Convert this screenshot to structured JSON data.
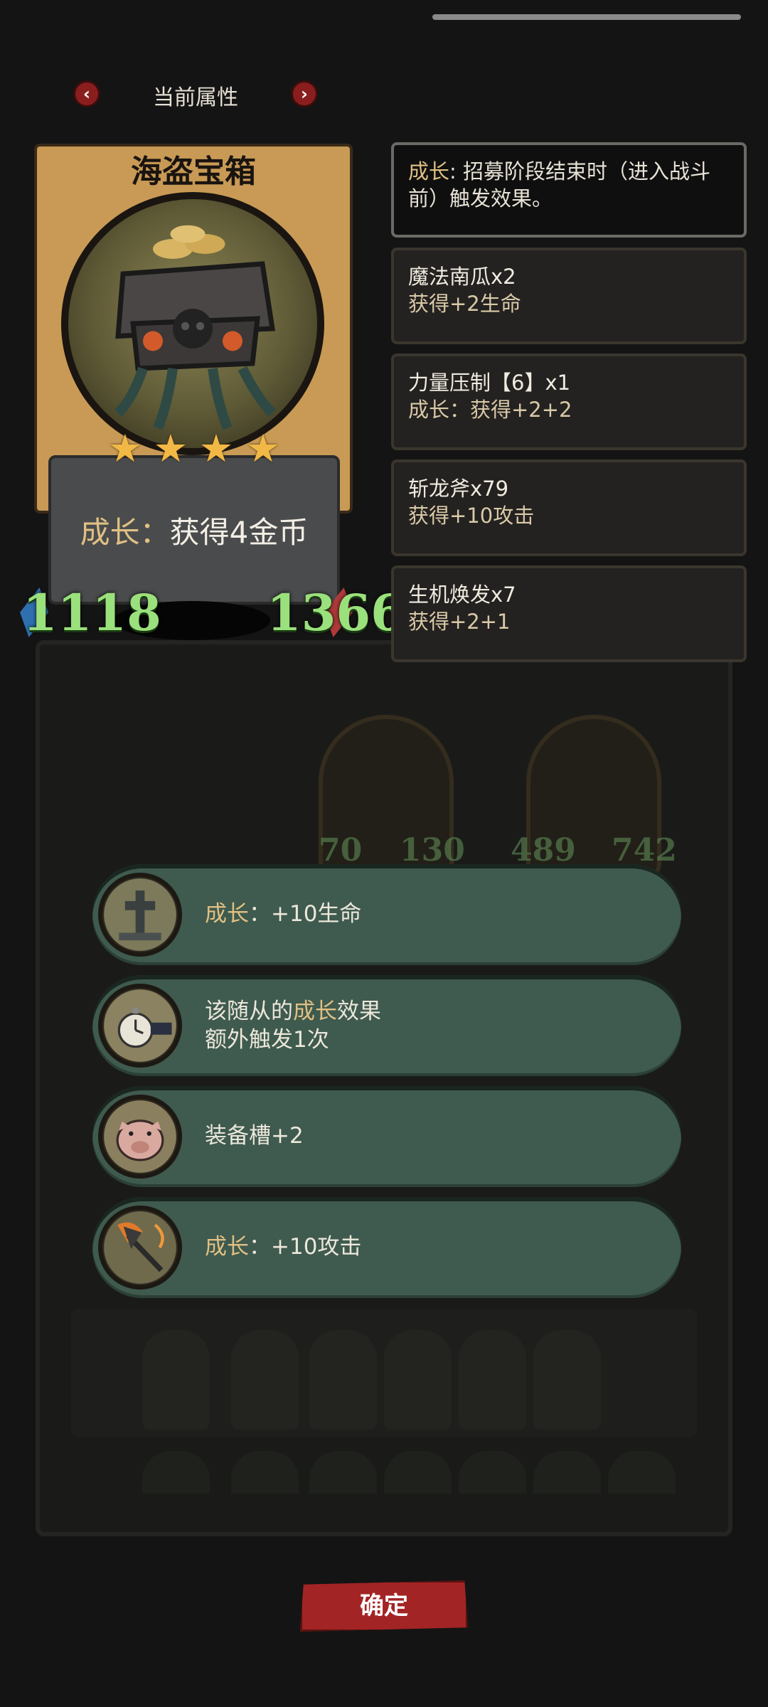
{
  "header": {
    "title": "当前属性",
    "prev_label": "‹",
    "next_label": "›"
  },
  "card": {
    "name": "海盗宝箱",
    "stars": 4,
    "star_glyph": "★",
    "desc_keyword": "成长",
    "desc_sep": "：",
    "desc_text": "获得4金币",
    "attack": "1118",
    "health": "1366",
    "colors": {
      "attack": "#9ae07c",
      "frame": "#c89a55"
    }
  },
  "tips": [
    {
      "kw": "成长",
      "line1": ": 招募阶段结束时（进入战斗",
      "line2": "前）触发效果。"
    },
    {
      "name": "魔法南瓜x2",
      "effect": "获得+2生命"
    },
    {
      "name": "力量压制【6】x1",
      "effect": "成长：获得+2+2"
    },
    {
      "name": "斩龙斧x79",
      "effect": "获得+10攻击"
    },
    {
      "name": "生机焕发x7",
      "effect": "获得+2+1"
    }
  ],
  "options": [
    {
      "icon": "gravestone-icon",
      "kw": "成长",
      "text": "：+10生命"
    },
    {
      "icon": "stopwatch-icon",
      "pre": "该随从的",
      "kw": "成长",
      "post": "效果",
      "line2": "额外触发1次"
    },
    {
      "icon": "pig-icon",
      "text": "装备槽+2"
    },
    {
      "icon": "flaming-axe-icon",
      "kw": "成长",
      "text": "：+10攻击"
    }
  ],
  "background": {
    "portrait_stats": [
      "70",
      "130",
      "489",
      "742"
    ]
  },
  "confirm": {
    "label": "确定"
  },
  "accent": "#e0c083"
}
